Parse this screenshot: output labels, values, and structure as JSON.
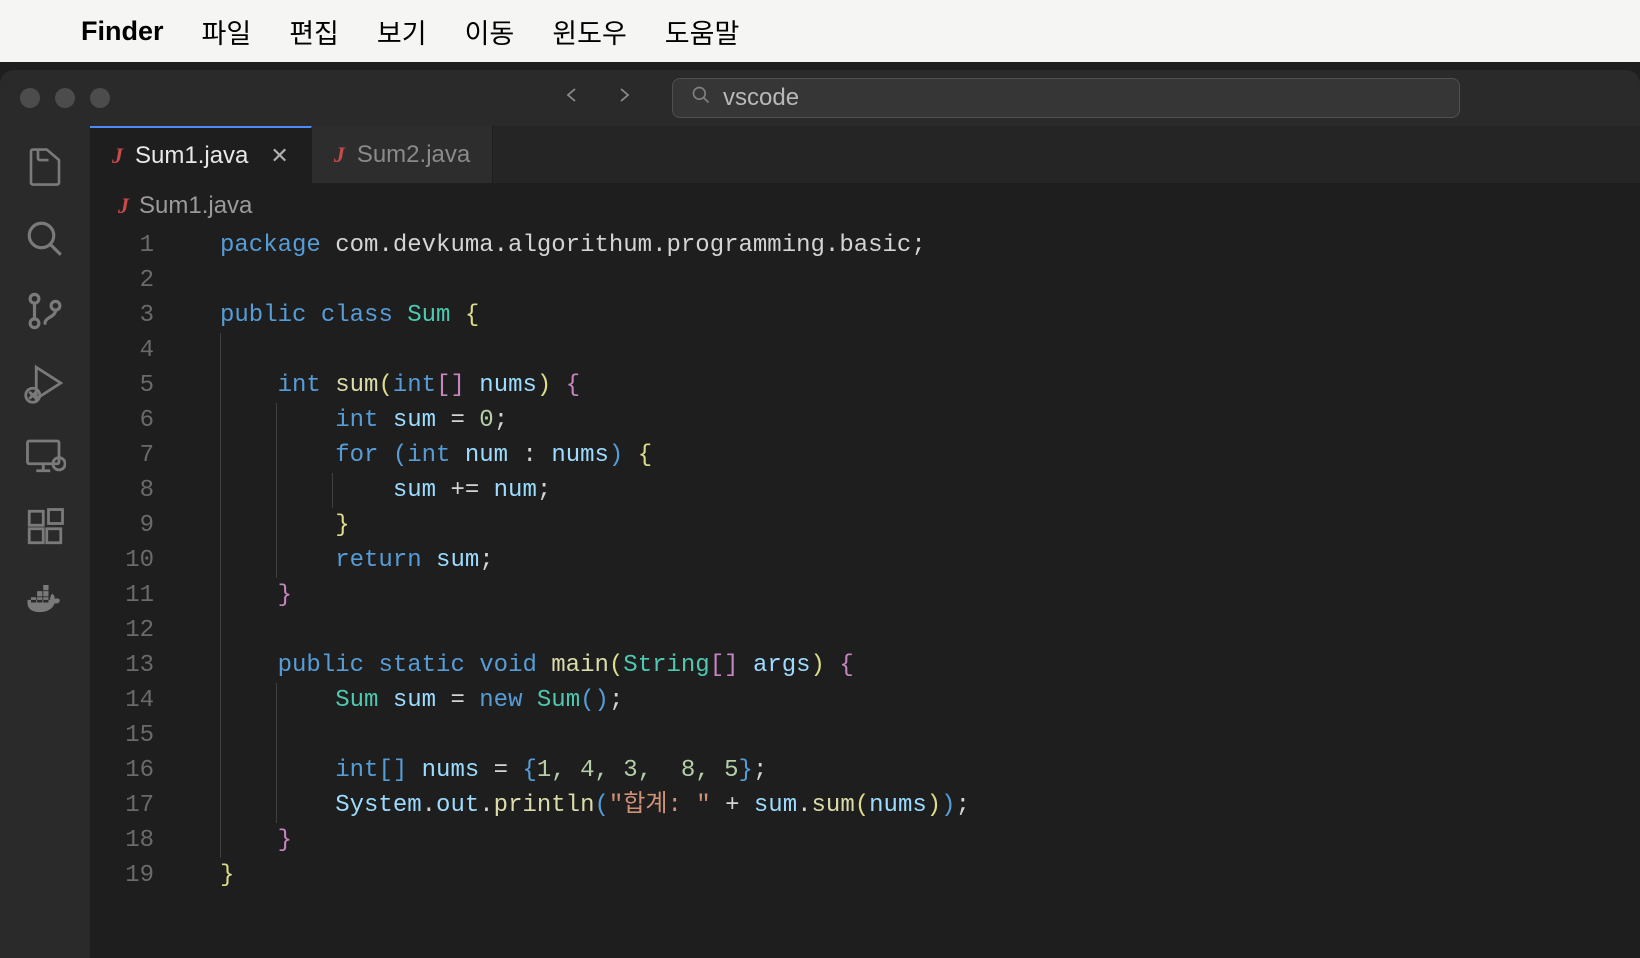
{
  "menubar": {
    "app": "Finder",
    "items": [
      "파일",
      "편집",
      "보기",
      "이동",
      "윈도우",
      "도움말"
    ]
  },
  "titlebar": {
    "search_text": "vscode"
  },
  "tabs": [
    {
      "label": "Sum1.java",
      "icon": "J",
      "active": true
    },
    {
      "label": "Sum2.java",
      "icon": "J",
      "active": false
    }
  ],
  "breadcrumb": {
    "icon": "J",
    "filename": "Sum1.java"
  },
  "code": {
    "line_numbers": [
      "1",
      "2",
      "3",
      "4",
      "5",
      "6",
      "7",
      "8",
      "9",
      "10",
      "11",
      "12",
      "13",
      "14",
      "15",
      "16",
      "17",
      "18",
      "19"
    ],
    "tokens": {
      "l1": {
        "kw1": "package",
        "pkg": " com.devkuma.algorithum.programming.basic",
        "semi": ";"
      },
      "l3": {
        "kw1": "public",
        "kw2": "class",
        "cls": "Sum",
        "brace": "{"
      },
      "l5": {
        "type1": "int",
        "fn": "sum",
        "lp": "(",
        "type2": "int",
        "br": "[]",
        "param": "nums",
        "rp": ")",
        "brace": "{"
      },
      "l6": {
        "type": "int",
        "var": "sum",
        "eq": " = ",
        "num": "0",
        "semi": ";"
      },
      "l7": {
        "kw": "for",
        "lp": "(",
        "type": "int",
        "var": "num",
        "colon": " : ",
        "arr": "nums",
        "rp": ")",
        "brace": "{"
      },
      "l8": {
        "var1": "sum",
        "op": " += ",
        "var2": "num",
        "semi": ";"
      },
      "l9": {
        "brace": "}"
      },
      "l10": {
        "kw": "return",
        "var": "sum",
        "semi": ";"
      },
      "l11": {
        "brace": "}"
      },
      "l13": {
        "kw1": "public",
        "kw2": "static",
        "kw3": "void",
        "fn": "main",
        "lp": "(",
        "type": "String",
        "br": "[]",
        "param": "args",
        "rp": ")",
        "brace": "{"
      },
      "l14": {
        "cls1": "Sum",
        "var": "sum",
        "eq": " = ",
        "kw": "new",
        "cls2": "Sum",
        "lp": "(",
        "rp": ")",
        "semi": ";"
      },
      "l16": {
        "type": "int",
        "br": "[]",
        "var": "nums",
        "eq": " = ",
        "lb": "{",
        "vals": "1, 4, 3,  8, 5",
        "rb": "}",
        "semi": ";"
      },
      "l17": {
        "obj1": "System",
        "dot1": ".",
        "obj2": "out",
        "dot2": ".",
        "fn": "println",
        "lp": "(",
        "str": "\"합계: \"",
        "plus": " + ",
        "var1": "sum",
        "dot3": ".",
        "fn2": "sum",
        "lp2": "(",
        "arg": "nums",
        "rp2": ")",
        "rp": ")",
        "semi": ";"
      },
      "l18": {
        "brace": "}"
      },
      "l19": {
        "brace": "}"
      }
    }
  }
}
